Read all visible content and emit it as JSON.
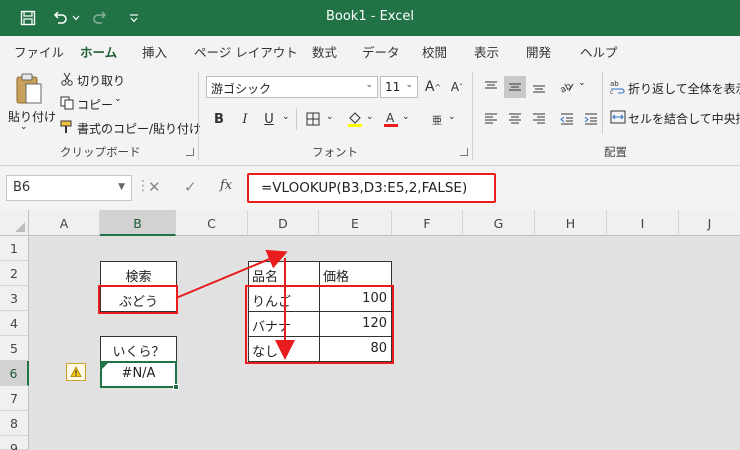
{
  "titlebar": {
    "title": "Book1  -  Excel"
  },
  "tabs": [
    "ファイル",
    "ホーム",
    "挿入",
    "ページ レイアウト",
    "数式",
    "データ",
    "校閲",
    "表示",
    "開発",
    "ヘルプ"
  ],
  "clipboard": {
    "paste": "貼り付け",
    "cut": "切り取り",
    "copy": "コピー",
    "format_painter": "書式のコピー/貼り付け",
    "group": "クリップボード"
  },
  "font": {
    "name": "游ゴシック",
    "size": "11",
    "bold": "B",
    "italic": "I",
    "underline": "U",
    "group": "フォント"
  },
  "alignment": {
    "wrap": "折り返して全体を表示す",
    "merge": "セルを結合して中央揃え",
    "group": "配置"
  },
  "formula_bar": {
    "name_box": "B6",
    "cancel": "✕",
    "enter": "✓",
    "fx": "fx",
    "formula": "=VLOOKUP(B3,D3:E5,2,FALSE)"
  },
  "columns": [
    "A",
    "B",
    "C",
    "D",
    "E",
    "F",
    "G",
    "H",
    "I",
    "J"
  ],
  "rows": [
    "1",
    "2",
    "3",
    "4",
    "5",
    "6",
    "7",
    "8",
    "9"
  ],
  "cells": {
    "b2": "検索",
    "b3": "ぶどう",
    "b5": "いくら？",
    "b6": "#N/A",
    "d2": "品名",
    "e2": "価格",
    "d3": "りんご",
    "e3": "100",
    "d4": "バナナ",
    "e4": "120",
    "d5": "なし",
    "e5": "80"
  },
  "colors": {
    "excel_green": "#217346",
    "annotation_red": "#e81c1c"
  }
}
